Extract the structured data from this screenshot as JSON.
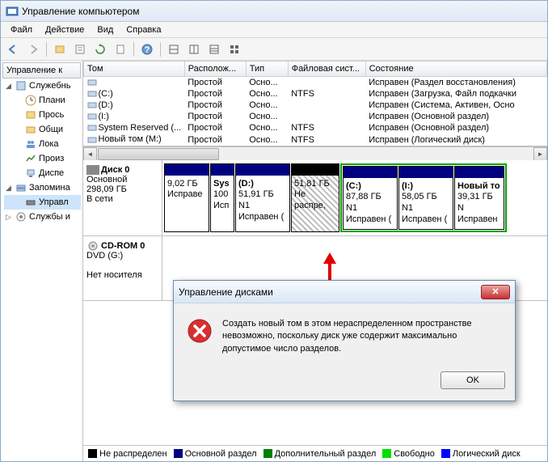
{
  "window": {
    "title": "Управление компьютером"
  },
  "menu": {
    "file": "Файл",
    "action": "Действие",
    "view": "Вид",
    "help": "Справка"
  },
  "tree": {
    "header": "Управление к",
    "nodes": {
      "root": "Служебнь",
      "plan": "Плани",
      "view": "Прось",
      "shared": "Общи",
      "local": "Лока",
      "perf": "Произ",
      "disp": "Диспе",
      "storage": "Запомина",
      "mgmt": "Управл",
      "svc": "Службы и"
    }
  },
  "grid": {
    "headers": {
      "vol": "Том",
      "layout": "Располож...",
      "type": "Тип",
      "fs": "Файловая сист...",
      "status": "Состояние"
    },
    "rows": [
      {
        "vol": "",
        "layout": "Простой",
        "type": "Осно...",
        "fs": "",
        "status": "Исправен (Раздел восстановления)"
      },
      {
        "vol": "(C:)",
        "layout": "Простой",
        "type": "Осно...",
        "fs": "NTFS",
        "status": "Исправен (Загрузка, Файл подкачки"
      },
      {
        "vol": "(D:)",
        "layout": "Простой",
        "type": "Осно...",
        "fs": "",
        "status": "Исправен (Система, Активен, Осно"
      },
      {
        "vol": "(I:)",
        "layout": "Простой",
        "type": "Осно...",
        "fs": "",
        "status": "Исправен (Основной раздел)"
      },
      {
        "vol": "System Reserved (...",
        "layout": "Простой",
        "type": "Осно...",
        "fs": "NTFS",
        "status": "Исправен (Основной раздел)"
      },
      {
        "vol": "Новый том (M:)",
        "layout": "Простой",
        "type": "Осно...",
        "fs": "NTFS",
        "status": "Исправен (Логический диск)"
      }
    ]
  },
  "disk0": {
    "name": "Диск 0",
    "type": "Основной",
    "size": "298,09 ГБ",
    "status": "В сети",
    "parts": [
      {
        "label": "",
        "size": "9,02 ГБ",
        "status": "Исправе"
      },
      {
        "label": "Sys",
        "size": "100",
        "status": "Исп"
      },
      {
        "label": "(D:)",
        "size": "51,91 ГБ N1",
        "status": "Исправен ("
      },
      {
        "label": "",
        "size": "51,81 ГБ",
        "status": "Не распре,"
      },
      {
        "label": "(C:)",
        "size": "87,88 ГБ N1",
        "status": "Исправен ("
      },
      {
        "label": "(I:)",
        "size": "58,05 ГБ N1",
        "status": "Исправен ("
      },
      {
        "label": "Новый то",
        "size": "39,31 ГБ N",
        "status": "Исправен"
      }
    ]
  },
  "cdrom": {
    "name": "CD-ROM 0",
    "type": "DVD (G:)",
    "status": "Нет носителя"
  },
  "legend": {
    "unalloc": "Не распределен",
    "primary": "Основной раздел",
    "extended": "Дополнительный раздел",
    "free": "Свободно",
    "logical": "Логический диск"
  },
  "dialog": {
    "title": "Управление дисками",
    "message": "Создать новый том в этом нераспределенном пространстве невозможно, поскольку диск уже содержит максимально допустимое число разделов.",
    "ok": "OK"
  }
}
